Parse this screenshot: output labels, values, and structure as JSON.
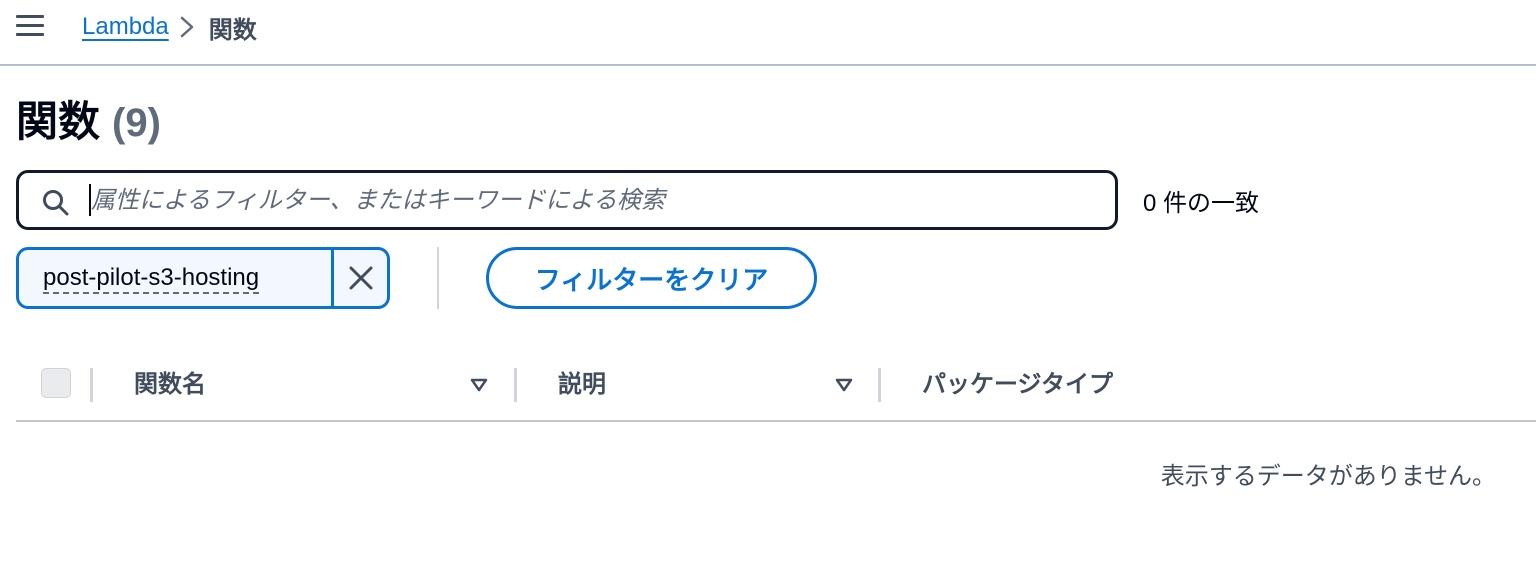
{
  "breadcrumb": {
    "root": "Lambda",
    "current": "関数"
  },
  "page": {
    "title": "関数",
    "count": "(9)"
  },
  "search": {
    "placeholder": "属性によるフィルター、またはキーワードによる検索",
    "value": "",
    "match_count": "0 件の一致"
  },
  "filter_token": {
    "label": "post-pilot-s3-hosting"
  },
  "clear_filters_label": "フィルターをクリア",
  "table": {
    "columns": [
      "関数名",
      "説明",
      "パッケージタイプ"
    ],
    "empty_message": "表示するデータがありません。"
  },
  "colors": {
    "link": "#0972d3",
    "text": "#000716",
    "muted": "#414d5c"
  }
}
